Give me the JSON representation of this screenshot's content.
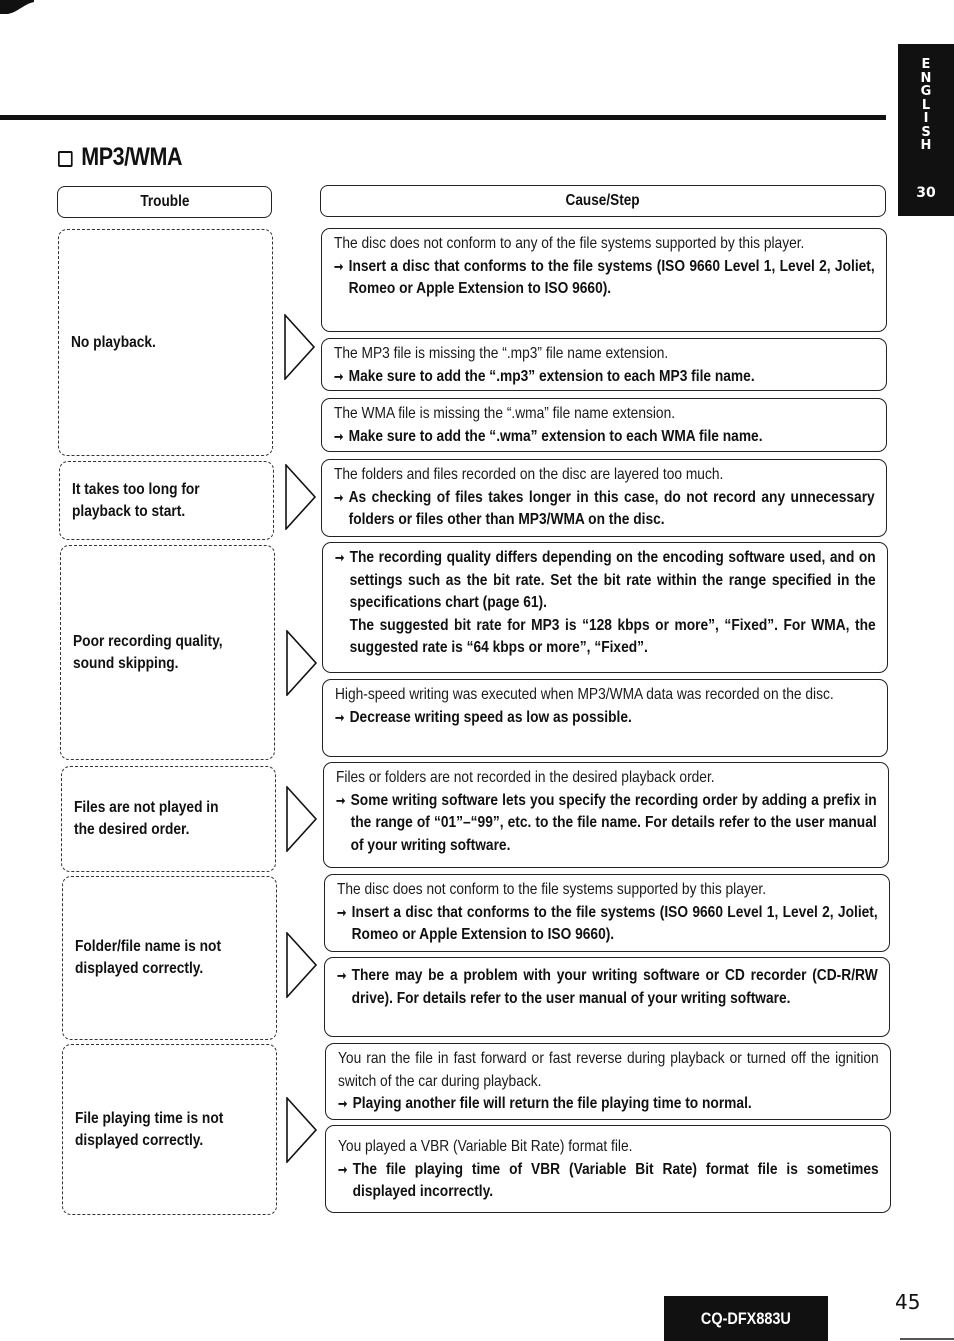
{
  "side_tab": {
    "language_letters": [
      "E",
      "N",
      "G",
      "L",
      "I",
      "S",
      "H"
    ],
    "section_number": "30"
  },
  "section": {
    "title": "MP3/WMA",
    "icon": "square-bullet-icon"
  },
  "table": {
    "headers": {
      "trouble": "Trouble",
      "cause_step": "Cause/Step"
    },
    "rows": [
      {
        "trouble": [
          "No playback."
        ],
        "causes": [
          {
            "cause": "The disc does not conform to any of the file systems supported by this player.",
            "step": "Insert a disc that conforms to the file systems (ISO 9660 Level 1, Level 2, Joliet, Romeo or Apple Extension to ISO 9660)."
          },
          {
            "cause": "The MP3 file is missing the “.mp3” file name extension.",
            "step": "Make sure to add the “.mp3” extension to each MP3 file name."
          },
          {
            "cause": "The WMA file is missing the “.wma” file name extension.",
            "step": "Make sure to add the “.wma” extension to each WMA file name."
          }
        ]
      },
      {
        "trouble": [
          "It takes too long for",
          "playback to start."
        ],
        "causes": [
          {
            "cause": "The folders and files recorded on the disc are layered too much.",
            "step": "As checking of files takes longer in this case, do not record any unnecessary folders or files other than MP3/WMA on the disc."
          }
        ]
      },
      {
        "trouble": [
          "Poor recording quality,",
          "sound skipping."
        ],
        "causes": [
          {
            "cause": "",
            "step": "The recording quality differs depending on the encoding software used, and on settings such as the bit rate. Set the bit rate within the range specified in the specifications chart (page 61).",
            "step_continued": "The suggested bit rate for MP3 is “128 kbps or more”, “Fixed”. For WMA, the suggested rate is “64 kbps or more”, “Fixed”."
          },
          {
            "cause": "High-speed writing was executed when MP3/WMA data was recorded on the disc.",
            "step": "Decrease writing speed as low as possible."
          }
        ]
      },
      {
        "trouble": [
          "Files are not played in",
          "the desired order."
        ],
        "causes": [
          {
            "cause": "Files or folders are not recorded in the desired playback order.",
            "step": "Some writing software lets you specify the recording order by adding a prefix in the range of “01”–“99”, etc. to the file name. For details refer to the user manual of your writing software."
          }
        ]
      },
      {
        "trouble": [
          "Folder/file name is not",
          "displayed correctly."
        ],
        "causes": [
          {
            "cause": "The disc does not conform to the file systems supported by this player.",
            "step": "Insert a disc that conforms to the file systems (ISO 9660 Level 1, Level 2, Joliet, Romeo or Apple Extension to ISO 9660)."
          },
          {
            "cause": "",
            "step": "There may be a problem with your writing software or CD recorder (CD-R/RW drive). For details refer to the user manual of your writing software."
          }
        ]
      },
      {
        "trouble": [
          "File playing time is not",
          "displayed correctly."
        ],
        "causes": [
          {
            "cause": "You ran the file in fast forward or fast reverse during playback or turned off the ignition switch of the car during playback.",
            "step": "Playing another file will return the file playing time to normal."
          },
          {
            "cause": "You played a VBR (Variable Bit Rate) format file.",
            "step": "The file playing time of VBR (Variable Bit Rate) format file is sometimes displayed incorrectly."
          }
        ]
      }
    ]
  },
  "step_marker_icon": "right-arrow-icon",
  "step_marker_glyph": "➞",
  "footer": {
    "model": "CQ-DFX883U",
    "page_number": "45"
  }
}
